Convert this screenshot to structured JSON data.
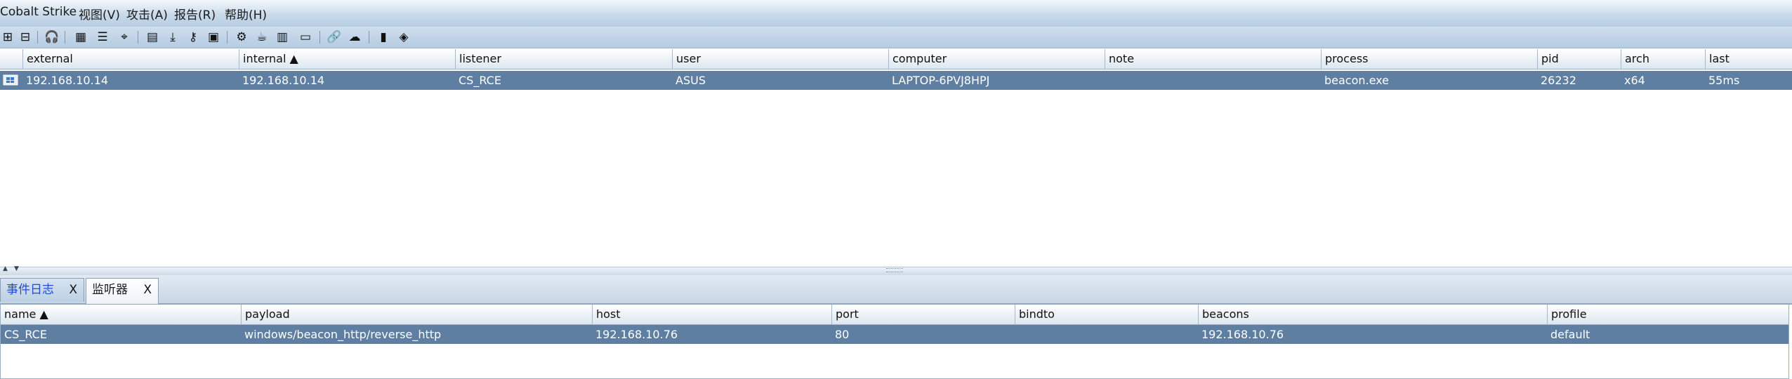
{
  "menubar": {
    "items": [
      "Cobalt Strike",
      "视图(V)",
      "攻击(A)",
      "报告(R)",
      "帮助(H)"
    ]
  },
  "toolbar": {
    "buttons": [
      {
        "icon": "plus-icon",
        "glyph": "⊞"
      },
      {
        "icon": "minus-icon",
        "glyph": "⊟"
      },
      {
        "icon": "headphones-icon",
        "glyph": "🎧"
      },
      {
        "icon": "pivot-graph-icon",
        "glyph": "▦"
      },
      {
        "icon": "session-list-icon",
        "glyph": "☰"
      },
      {
        "icon": "target-icon",
        "glyph": "⌖"
      },
      {
        "icon": "credentials-icon",
        "glyph": "▤"
      },
      {
        "icon": "download-icon",
        "glyph": "⤓"
      },
      {
        "icon": "key-icon",
        "glyph": "⚷"
      },
      {
        "icon": "screenshot-icon",
        "glyph": "▣"
      },
      {
        "icon": "gear-icon",
        "glyph": "⚙"
      },
      {
        "icon": "coffee-icon",
        "glyph": "☕"
      },
      {
        "icon": "document-icon",
        "glyph": "▥"
      },
      {
        "icon": "console-icon",
        "glyph": "▭"
      },
      {
        "icon": "link-icon",
        "glyph": "🔗"
      },
      {
        "icon": "cloud-icon",
        "glyph": "☁"
      },
      {
        "icon": "book-icon",
        "glyph": "▮"
      },
      {
        "icon": "cube-icon",
        "glyph": "◈"
      }
    ]
  },
  "sessions": {
    "columns": [
      "external",
      "internal ▲",
      "listener",
      "user",
      "computer",
      "note",
      "process",
      "pid",
      "arch",
      "last"
    ],
    "rows": [
      {
        "external": "192.168.10.14",
        "internal": "192.168.10.14",
        "listener": "CS_RCE",
        "user": "ASUS",
        "computer": "LAPTOP-6PVJ8HPJ",
        "note": "",
        "process": "beacon.exe",
        "pid": "26232",
        "arch": "x64",
        "last": "55ms"
      }
    ]
  },
  "tabs": [
    {
      "label": "事件日志",
      "close": "X"
    },
    {
      "label": "监听器",
      "close": "X"
    }
  ],
  "listeners": {
    "columns": [
      "name ▲",
      "payload",
      "host",
      "port",
      "bindto",
      "beacons",
      "profile"
    ],
    "rows": [
      {
        "name": "CS_RCE",
        "payload": "windows/beacon_http/reverse_http",
        "host": "192.168.10.76",
        "port": "80",
        "bindto": "",
        "beacons": "192.168.10.76",
        "profile": "default"
      }
    ]
  },
  "colors": {
    "selected_row": "#5e7fa2",
    "accent": "#1f4fd0"
  }
}
